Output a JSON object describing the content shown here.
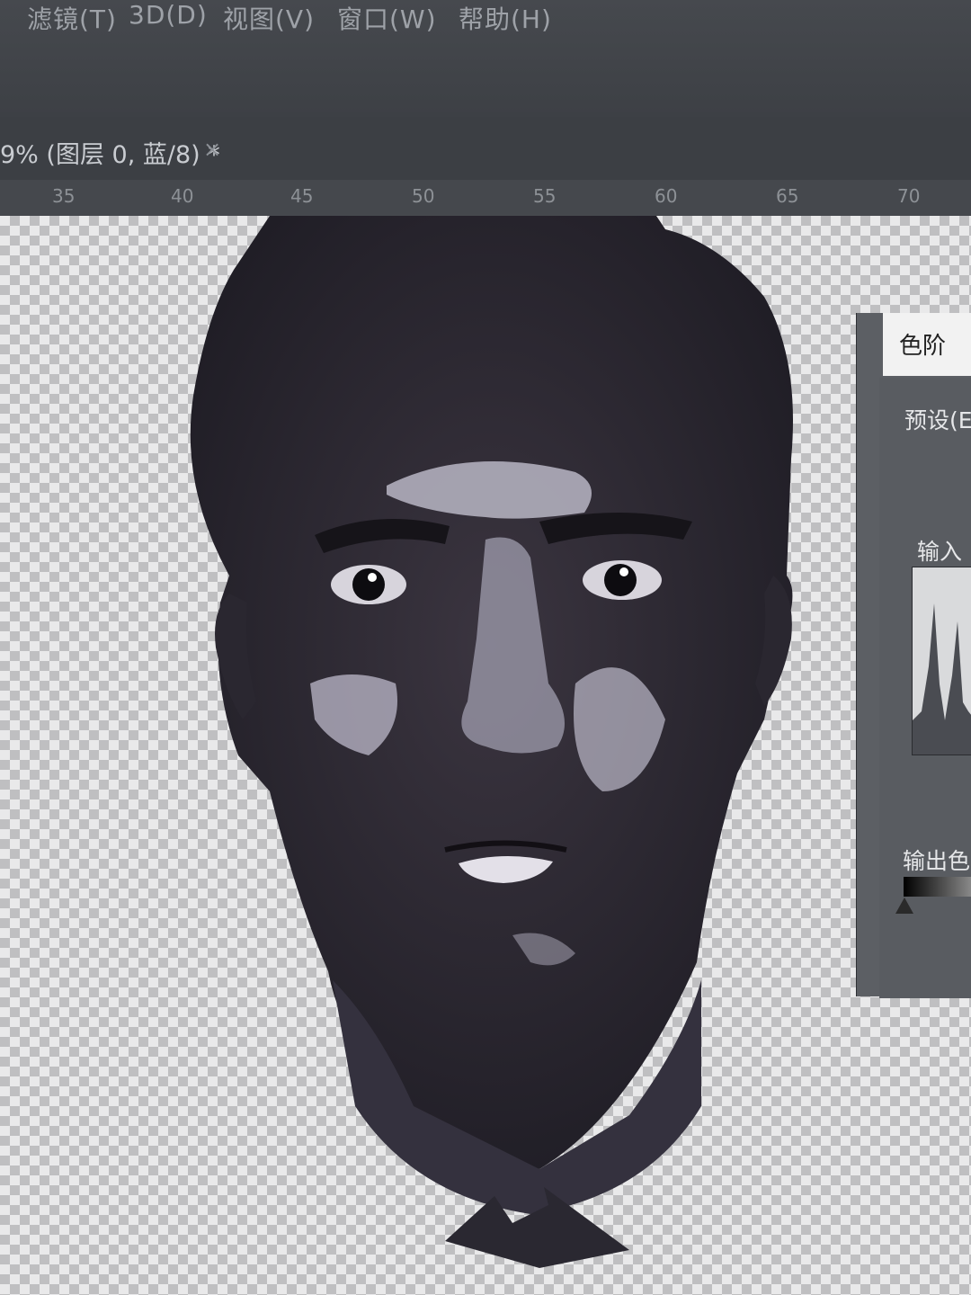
{
  "menubar": {
    "items": [
      "滤镜(T)",
      "3D(D)",
      "视图(V)",
      "窗口(W)",
      "帮助(H)"
    ]
  },
  "document_tab": {
    "title": "9% (图层 0, 蓝/8) *",
    "close_label": "×"
  },
  "ruler": {
    "marks": [
      "35",
      "40",
      "45",
      "50",
      "55",
      "60",
      "65",
      "70"
    ]
  },
  "levels_panel": {
    "title": "色阶",
    "preset_label": "预设(E",
    "input_label": "输入",
    "output_label": "输出色"
  },
  "colors": {
    "menubar_bg": "#46494e",
    "panel_bg": "#5c5f64",
    "checker_light": "#e9e9ea",
    "checker_dark": "#bfbfc1",
    "figure_dark": "#2b2932"
  }
}
